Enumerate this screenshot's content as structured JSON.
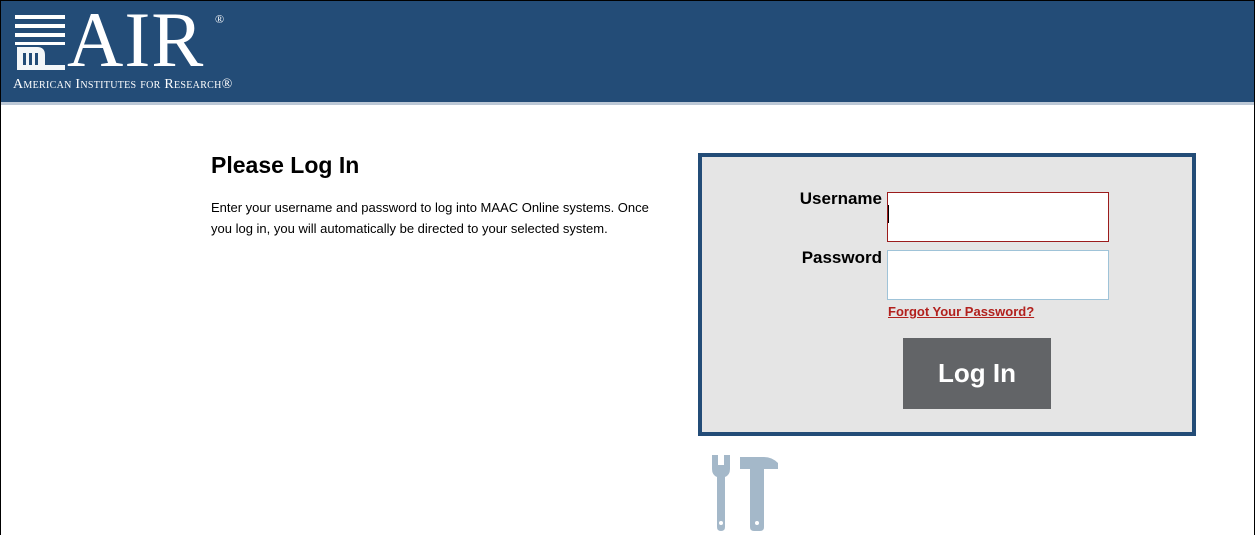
{
  "header": {
    "logo_word": "AIR",
    "logo_reg": "®",
    "logo_sub": "American Institutes for Research®",
    "icon": "pillar-building-icon"
  },
  "intro": {
    "title": "Please Log In",
    "description": "Enter your username and password to log into MAAC Online systems. Once you log in, you will automatically be directed to your selected system."
  },
  "login_form": {
    "username_label": "Username",
    "password_label": "Password",
    "username_value": "",
    "password_value": "",
    "forgot_link": "Forgot Your Password?",
    "submit_label": "Log In"
  },
  "footer": {
    "icon": "tools-icon"
  },
  "colors": {
    "header_bg": "#234c77",
    "box_border": "#234c77",
    "box_bg": "#e5e5e5",
    "link": "#b2201d",
    "button_bg": "#626467"
  }
}
